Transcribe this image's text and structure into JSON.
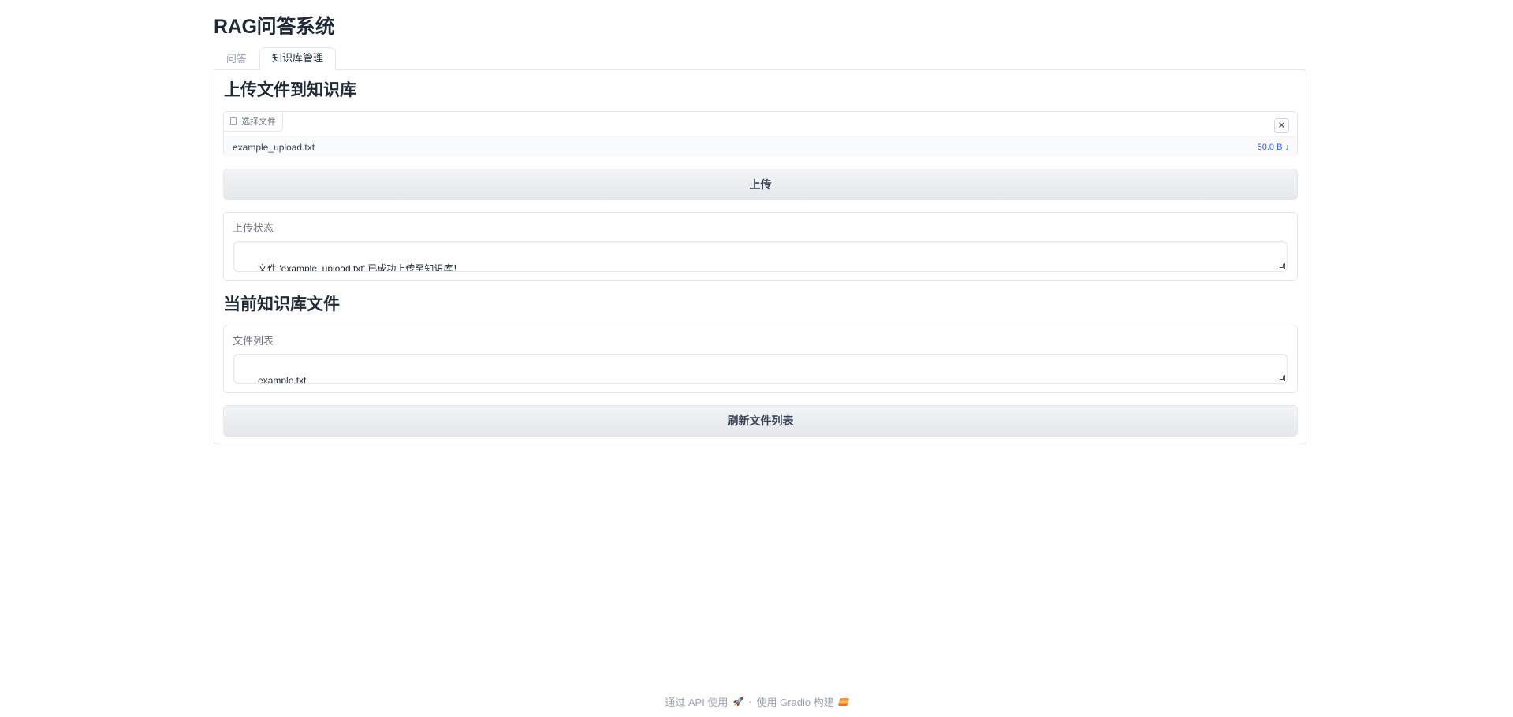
{
  "app": {
    "title": "RAG问答系统"
  },
  "tabs": [
    {
      "label": "问答",
      "active": false
    },
    {
      "label": "知识库管理",
      "active": true
    }
  ],
  "upload_section": {
    "title": "上传文件到知识库",
    "file_input_label": "选择文件",
    "file": {
      "name": "example_upload.txt",
      "size": "50.0 B ↓"
    },
    "upload_button": "上传",
    "status_label": "上传状态",
    "status_value": "文件 'example_upload.txt' 已成功上传至知识库！"
  },
  "files_section": {
    "title": "当前知识库文件",
    "list_label": "文件列表",
    "list_value": "example.txt\nexample_upload.txt",
    "refresh_button": "刷新文件列表"
  },
  "footer": {
    "api_link": "通过 API 使用",
    "separator": "·",
    "gradio_link": "使用 Gradio 构建"
  },
  "colors": {
    "accent": "#2563eb",
    "border": "#e5e7eb",
    "gradio_orange": "#f97316"
  },
  "icons": [
    "file-icon",
    "close-icon",
    "rocket-icon",
    "gradio-logo-icon"
  ]
}
